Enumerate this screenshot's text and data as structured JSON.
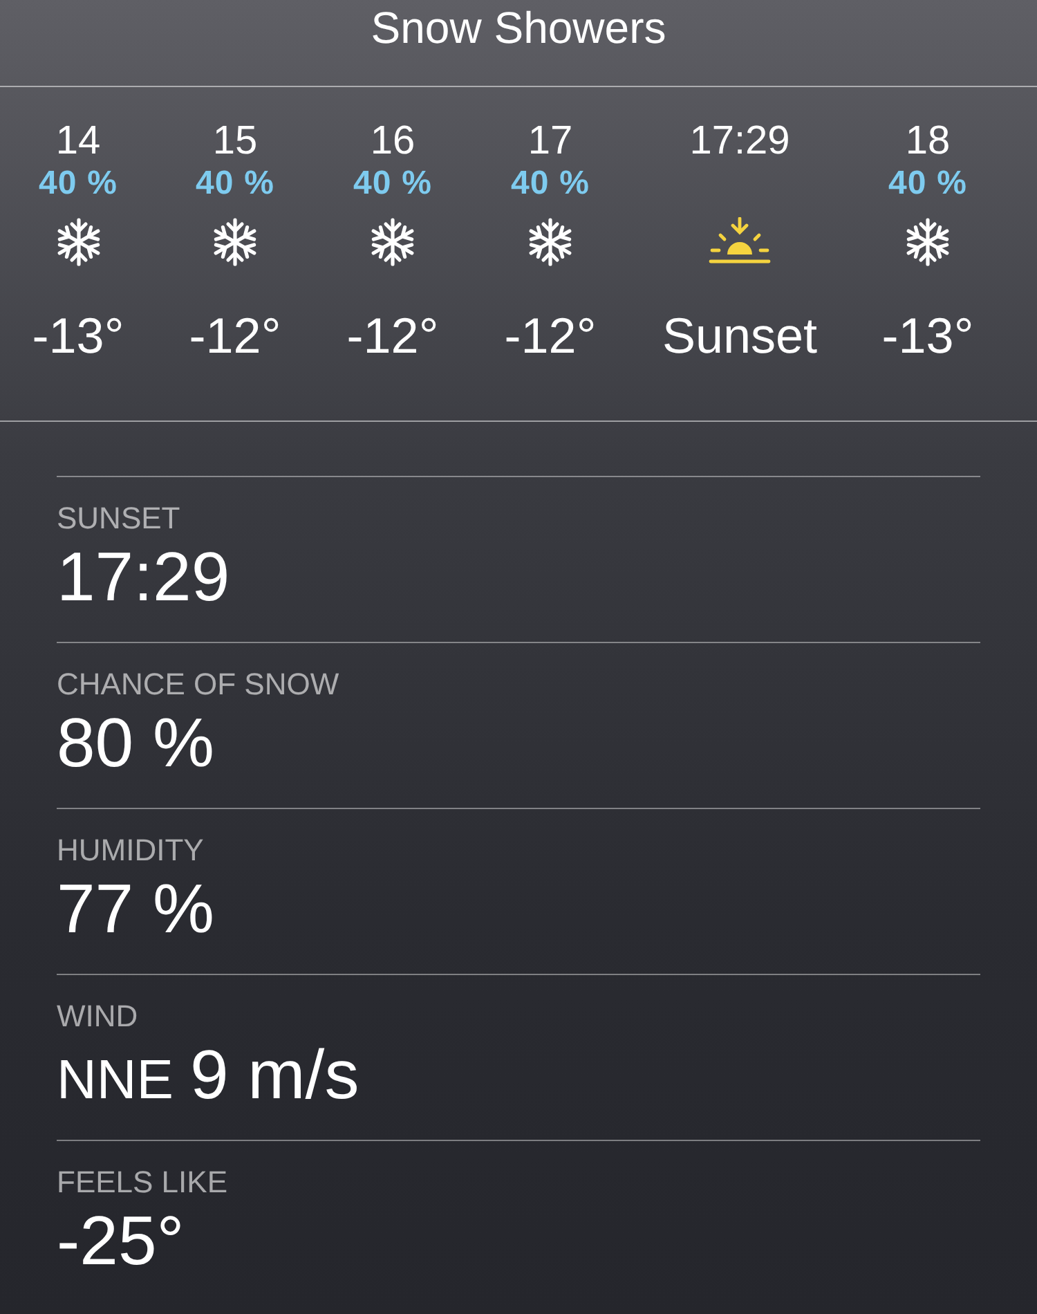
{
  "condition": "Snow Showers",
  "hourly": [
    {
      "time": "14",
      "chance": "40 %",
      "kind": "snow",
      "temp": "-13°"
    },
    {
      "time": "15",
      "chance": "40 %",
      "kind": "snow",
      "temp": "-12°"
    },
    {
      "time": "16",
      "chance": "40 %",
      "kind": "snow",
      "temp": "-12°"
    },
    {
      "time": "17",
      "chance": "40 %",
      "kind": "snow",
      "temp": "-12°"
    },
    {
      "time": "17:29",
      "kind": "sunset",
      "temp": "Sunset"
    },
    {
      "time": "18",
      "chance": "40 %",
      "kind": "snow",
      "temp": "-13°"
    }
  ],
  "details": [
    {
      "label": "SUNSET",
      "value": "17:29"
    },
    {
      "label": "CHANCE OF SNOW",
      "value": "80 %"
    },
    {
      "label": "HUMIDITY",
      "value": "77 %"
    },
    {
      "label": "WIND",
      "direction": "NNE",
      "value": "9 m/s"
    },
    {
      "label": "FEELS LIKE",
      "value": "-25°"
    }
  ]
}
